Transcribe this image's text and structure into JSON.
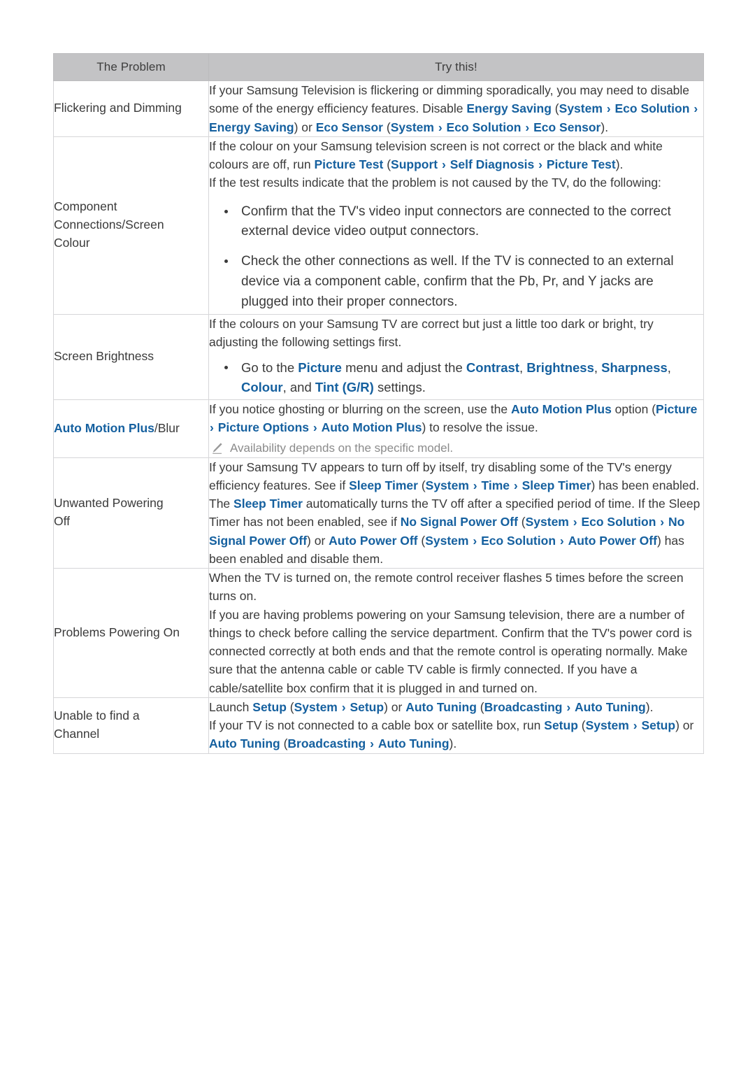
{
  "table": {
    "headers": {
      "problem": "The Problem",
      "try": "Try this!"
    },
    "colors": {
      "link_blue": "#15609f",
      "header_bg": "#c3c3c5",
      "body_text": "#3a3a3a",
      "note_grey": "#8b8b8b",
      "border": "#d6d6d8"
    },
    "rows": [
      {
        "problem": "Flickering and Dimming",
        "paragraphs": [
          "If your Samsung Television is flickering or dimming sporadically, you may need to disable some of the energy efficiency features. Disable Energy Saving (System > Eco Solution > Energy Saving) or Eco Sensor (System > Eco Solution > Eco Sensor)."
        ]
      },
      {
        "problem_lines": [
          "Component",
          "Connections/Screen",
          "Colour"
        ],
        "paragraphs": [
          "If the colour on your Samsung television screen is not correct or the black and white colours are off, run Picture Test (Support > Self Diagnosis > Picture Test).",
          "If the test results indicate that the problem is not caused by the TV, do the following:"
        ],
        "bullets": [
          "Confirm that the TV's video input connectors are connected to the correct external device video output connectors.",
          "Check the other connections as well. If the TV is connected to an external device via a component cable, confirm that the Pb, Pr, and Y jacks are plugged into their proper connectors."
        ]
      },
      {
        "problem": "Screen Brightness",
        "paragraphs": [
          "If the colours on your Samsung TV are correct but just a little too dark or bright, try adjusting the following settings first."
        ],
        "bullets": [
          "Go to the Picture menu and adjust the Contrast, Brightness, Sharpness, Colour, and Tint (G/R) settings."
        ]
      },
      {
        "problem_blue": "Auto Motion Plus",
        "problem_rest": "/Blur",
        "paragraphs": [
          "If you notice ghosting or blurring on the screen, use the Auto Motion Plus option (Picture > Picture Options > Auto Motion Plus) to resolve the issue."
        ],
        "note": "Availability depends on the specific model.",
        "note_icon": "pencil-icon"
      },
      {
        "problem_lines": [
          "Unwanted Powering",
          "Off"
        ],
        "paragraphs": [
          "If your Samsung TV appears to turn off by itself, try disabling some of the TV's energy efficiency features. See if Sleep Timer (System > Time > Sleep Timer) has been enabled. The Sleep Timer automatically turns the TV off after a specified period of time. If the Sleep Timer has not been enabled, see if No Signal Power Off (System > Eco Solution > No Signal Power Off) or Auto Power Off (System > Eco Solution > Auto Power Off) has been enabled and disable them."
        ]
      },
      {
        "problem": "Problems Powering On",
        "paragraphs": [
          "When the TV is turned on, the remote control receiver flashes 5 times before the screen turns on.",
          "If you are having problems powering on your Samsung television, there are a number of things to check before calling the service department. Confirm that the TV's power cord is connected correctly at both ends and that the remote control is operating normally. Make sure that the antenna cable or cable TV cable is firmly connected. If you have a cable/satellite box confirm that it is plugged in and turned on."
        ]
      },
      {
        "problem_lines": [
          "Unable to find a",
          "Channel"
        ],
        "paragraphs": [
          "Launch Setup (System > Setup) or Auto Tuning (Broadcasting > Auto Tuning).",
          "If your TV is not connected to a cable box or satellite box, run Setup (System > Setup) or Auto Tuning (Broadcasting > Auto Tuning)."
        ]
      }
    ]
  }
}
